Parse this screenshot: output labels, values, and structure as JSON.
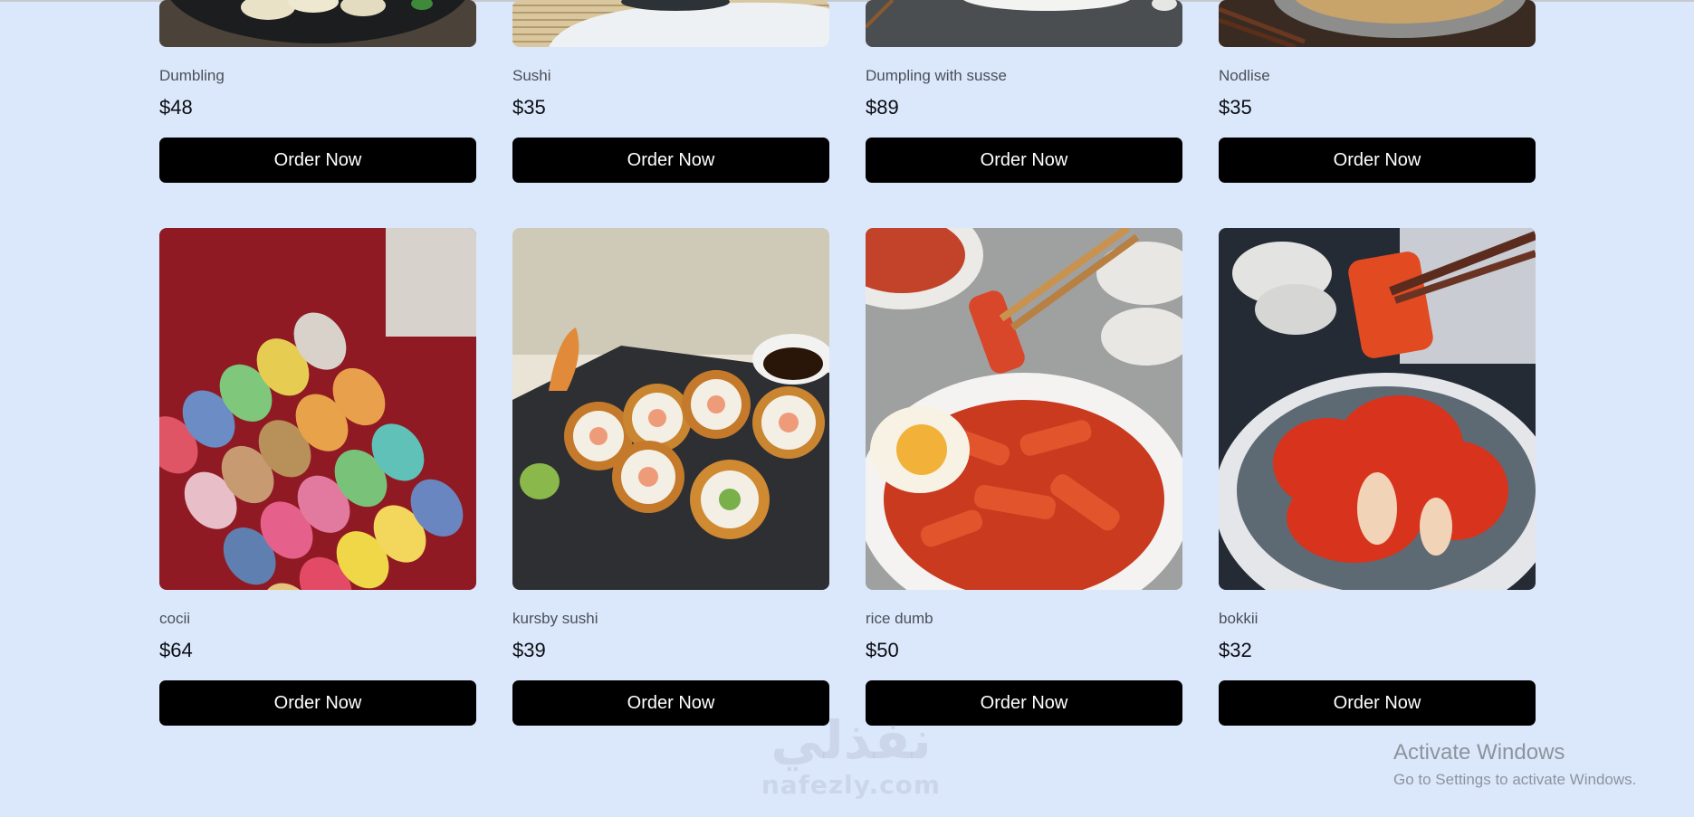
{
  "products": [
    {
      "name": "Dumbling",
      "price": "$48",
      "button": "Order Now",
      "image": "dumplings-on-dark-plate"
    },
    {
      "name": "Sushi",
      "price": "$35",
      "button": "Order Now",
      "image": "sushi-on-bamboo-mat"
    },
    {
      "name": "Dumpling with susse",
      "price": "$89",
      "button": "Order Now",
      "image": "dumplings-with-sauce"
    },
    {
      "name": "Nodlise",
      "price": "$35",
      "button": "Order Now",
      "image": "noodles-bowl-with-chopsticks"
    },
    {
      "name": "cocii",
      "price": "$64",
      "button": "Order Now",
      "image": "colorful-macarons-box"
    },
    {
      "name": "kursby sushi",
      "price": "$39",
      "button": "Order Now",
      "image": "crispy-sushi-rolls"
    },
    {
      "name": "rice dumb",
      "price": "$50",
      "button": "Order Now",
      "image": "tteokbokki-rice-cakes"
    },
    {
      "name": "bokkii",
      "price": "$32",
      "button": "Order Now",
      "image": "kimchi-bowl"
    }
  ],
  "watermark": {
    "arabic": "نفذلي",
    "latin": "nafezly.com"
  },
  "windows_notice": {
    "title": "Activate Windows",
    "subtitle": "Go to Settings to activate Windows."
  },
  "colors": {
    "background": "#dbe8fc",
    "button": "#000000",
    "button_text": "#ffffff"
  }
}
